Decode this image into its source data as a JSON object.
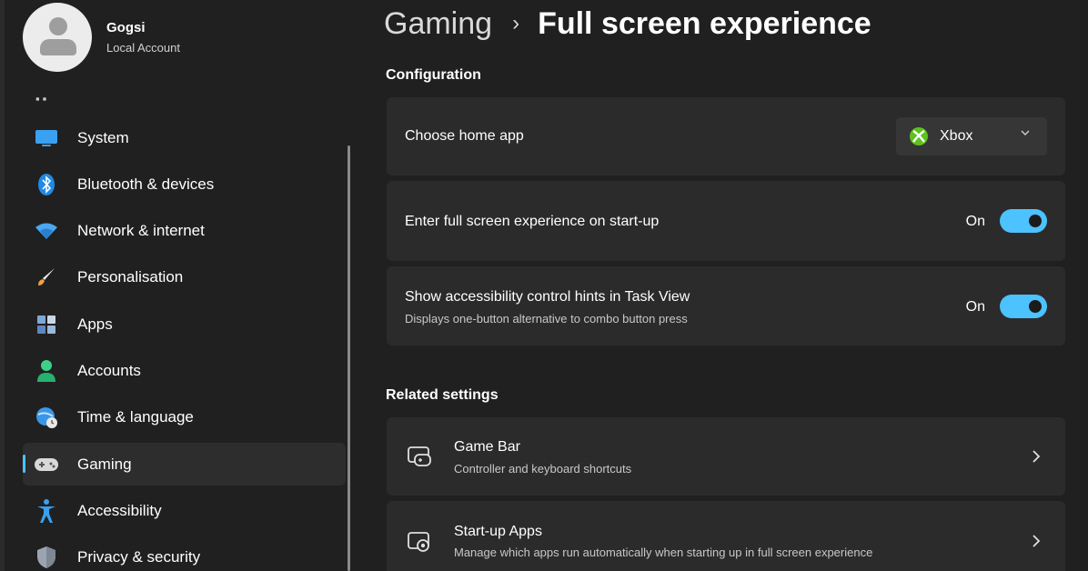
{
  "account": {
    "name": "Gogsi",
    "type": "Local Account"
  },
  "sidebar": {
    "items": [
      {
        "label": "System",
        "icon": "system-icon"
      },
      {
        "label": "Bluetooth & devices",
        "icon": "bluetooth-icon"
      },
      {
        "label": "Network & internet",
        "icon": "wifi-icon"
      },
      {
        "label": "Personalisation",
        "icon": "brush-icon"
      },
      {
        "label": "Apps",
        "icon": "apps-icon"
      },
      {
        "label": "Accounts",
        "icon": "person-icon"
      },
      {
        "label": "Time & language",
        "icon": "globe-clock-icon"
      },
      {
        "label": "Gaming",
        "icon": "gamepad-icon",
        "selected": true
      },
      {
        "label": "Accessibility",
        "icon": "accessibility-icon"
      },
      {
        "label": "Privacy & security",
        "icon": "shield-icon"
      }
    ]
  },
  "breadcrumb": {
    "parent": "Gaming",
    "current": "Full screen experience"
  },
  "configuration": {
    "title": "Configuration",
    "home_app": {
      "label": "Choose home app",
      "selected": "Xbox"
    },
    "startup_toggle": {
      "label": "Enter full screen experience on start-up",
      "state": "On",
      "value": true
    },
    "hints_toggle": {
      "label": "Show accessibility control hints in Task View",
      "description": "Displays one-button alternative to combo button press",
      "state": "On",
      "value": true
    }
  },
  "related": {
    "title": "Related settings",
    "links": [
      {
        "label": "Game Bar",
        "description": "Controller and keyboard shortcuts",
        "icon": "game-bar-icon"
      },
      {
        "label": "Start-up Apps",
        "description": "Manage which apps run automatically when starting up in full screen experience",
        "icon": "startup-apps-icon"
      }
    ]
  },
  "colors": {
    "accent": "#4cc2ff",
    "background": "#202020",
    "card": "#2b2b2b",
    "xbox_green": "#5dc21e"
  }
}
